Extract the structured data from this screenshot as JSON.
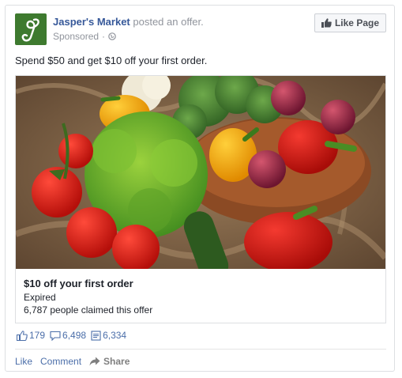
{
  "post": {
    "page_name": "Jasper's Market",
    "action_text": " posted an offer.",
    "sponsored_label": "Sponsored",
    "separator": "·",
    "like_page_label": "Like Page",
    "body_text": "Spend $50 and get $10 off your first order."
  },
  "offer": {
    "title": "$10 off your first order",
    "status": "Expired",
    "claimed_text": "6,787 people claimed this offer"
  },
  "stats": {
    "likes": "179",
    "comments": "6,498",
    "shares": "6,334"
  },
  "actions": {
    "like": "Like",
    "comment": "Comment",
    "share": "Share"
  },
  "colors": {
    "brand_blue": "#365899",
    "link_blue": "#4b6ea9",
    "avatar_green": "#3e7a2f"
  },
  "icons": {
    "avatar": "script-j-logo-icon",
    "like_page": "thumbs-up-icon",
    "globe": "globe-icon",
    "likes": "thumbs-up-icon",
    "comments": "comment-icon",
    "shares": "share-icon",
    "share_action": "share-arrow-icon"
  }
}
